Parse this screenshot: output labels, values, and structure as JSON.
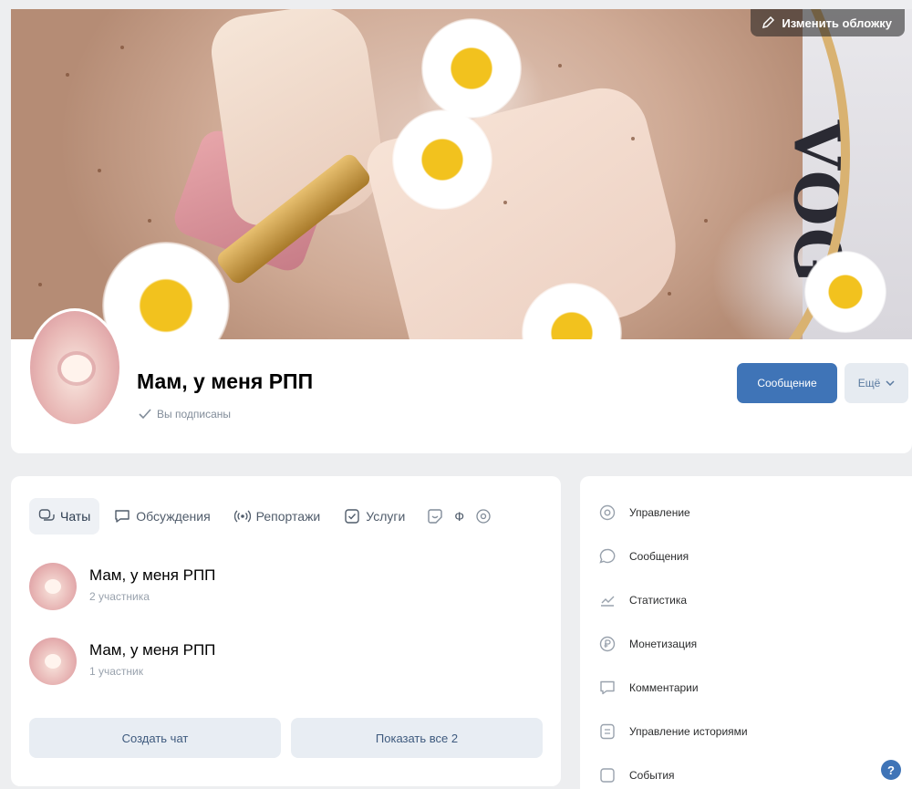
{
  "cover": {
    "edit_button_label": "Изменить обложку",
    "decor_text": "VOG"
  },
  "group": {
    "title": "Мам, у меня РПП",
    "subscription_status": "Вы подписаны"
  },
  "actions": {
    "message_label": "Сообщение",
    "more_label": "Ещё"
  },
  "tabs": [
    {
      "label": "Чаты",
      "icon": "chats-icon",
      "active": true
    },
    {
      "label": "Обсуждения",
      "icon": "discussion-icon",
      "active": false
    },
    {
      "label": "Репортажи",
      "icon": "broadcast-icon",
      "active": false
    },
    {
      "label": "Услуги",
      "icon": "services-icon",
      "active": false
    }
  ],
  "tab_extra": {
    "sticker_icon": "sticker-icon",
    "letter": "Ф",
    "settings_icon": "gear-icon"
  },
  "chats": [
    {
      "name": "Мам, у меня РПП",
      "members": "2 участника"
    },
    {
      "name": "Мам, у меня РПП",
      "members": "1 участник"
    }
  ],
  "chat_buttons": {
    "create_label": "Создать чат",
    "show_all_label": "Показать все 2"
  },
  "admin_menu": [
    {
      "label": "Управление",
      "icon": "gear-icon"
    },
    {
      "label": "Сообщения",
      "icon": "message-icon"
    },
    {
      "label": "Статистика",
      "icon": "stats-icon"
    },
    {
      "label": "Монетизация",
      "icon": "money-icon"
    },
    {
      "label": "Комментарии",
      "icon": "comment-icon"
    },
    {
      "label": "Управление историями",
      "icon": "stories-icon"
    },
    {
      "label": "События",
      "icon": "events-icon"
    }
  ],
  "help_badge": "?",
  "colors": {
    "primary_button": "#3f74b7",
    "secondary_button": "#e6ebf1",
    "page_background": "#edeef0"
  }
}
